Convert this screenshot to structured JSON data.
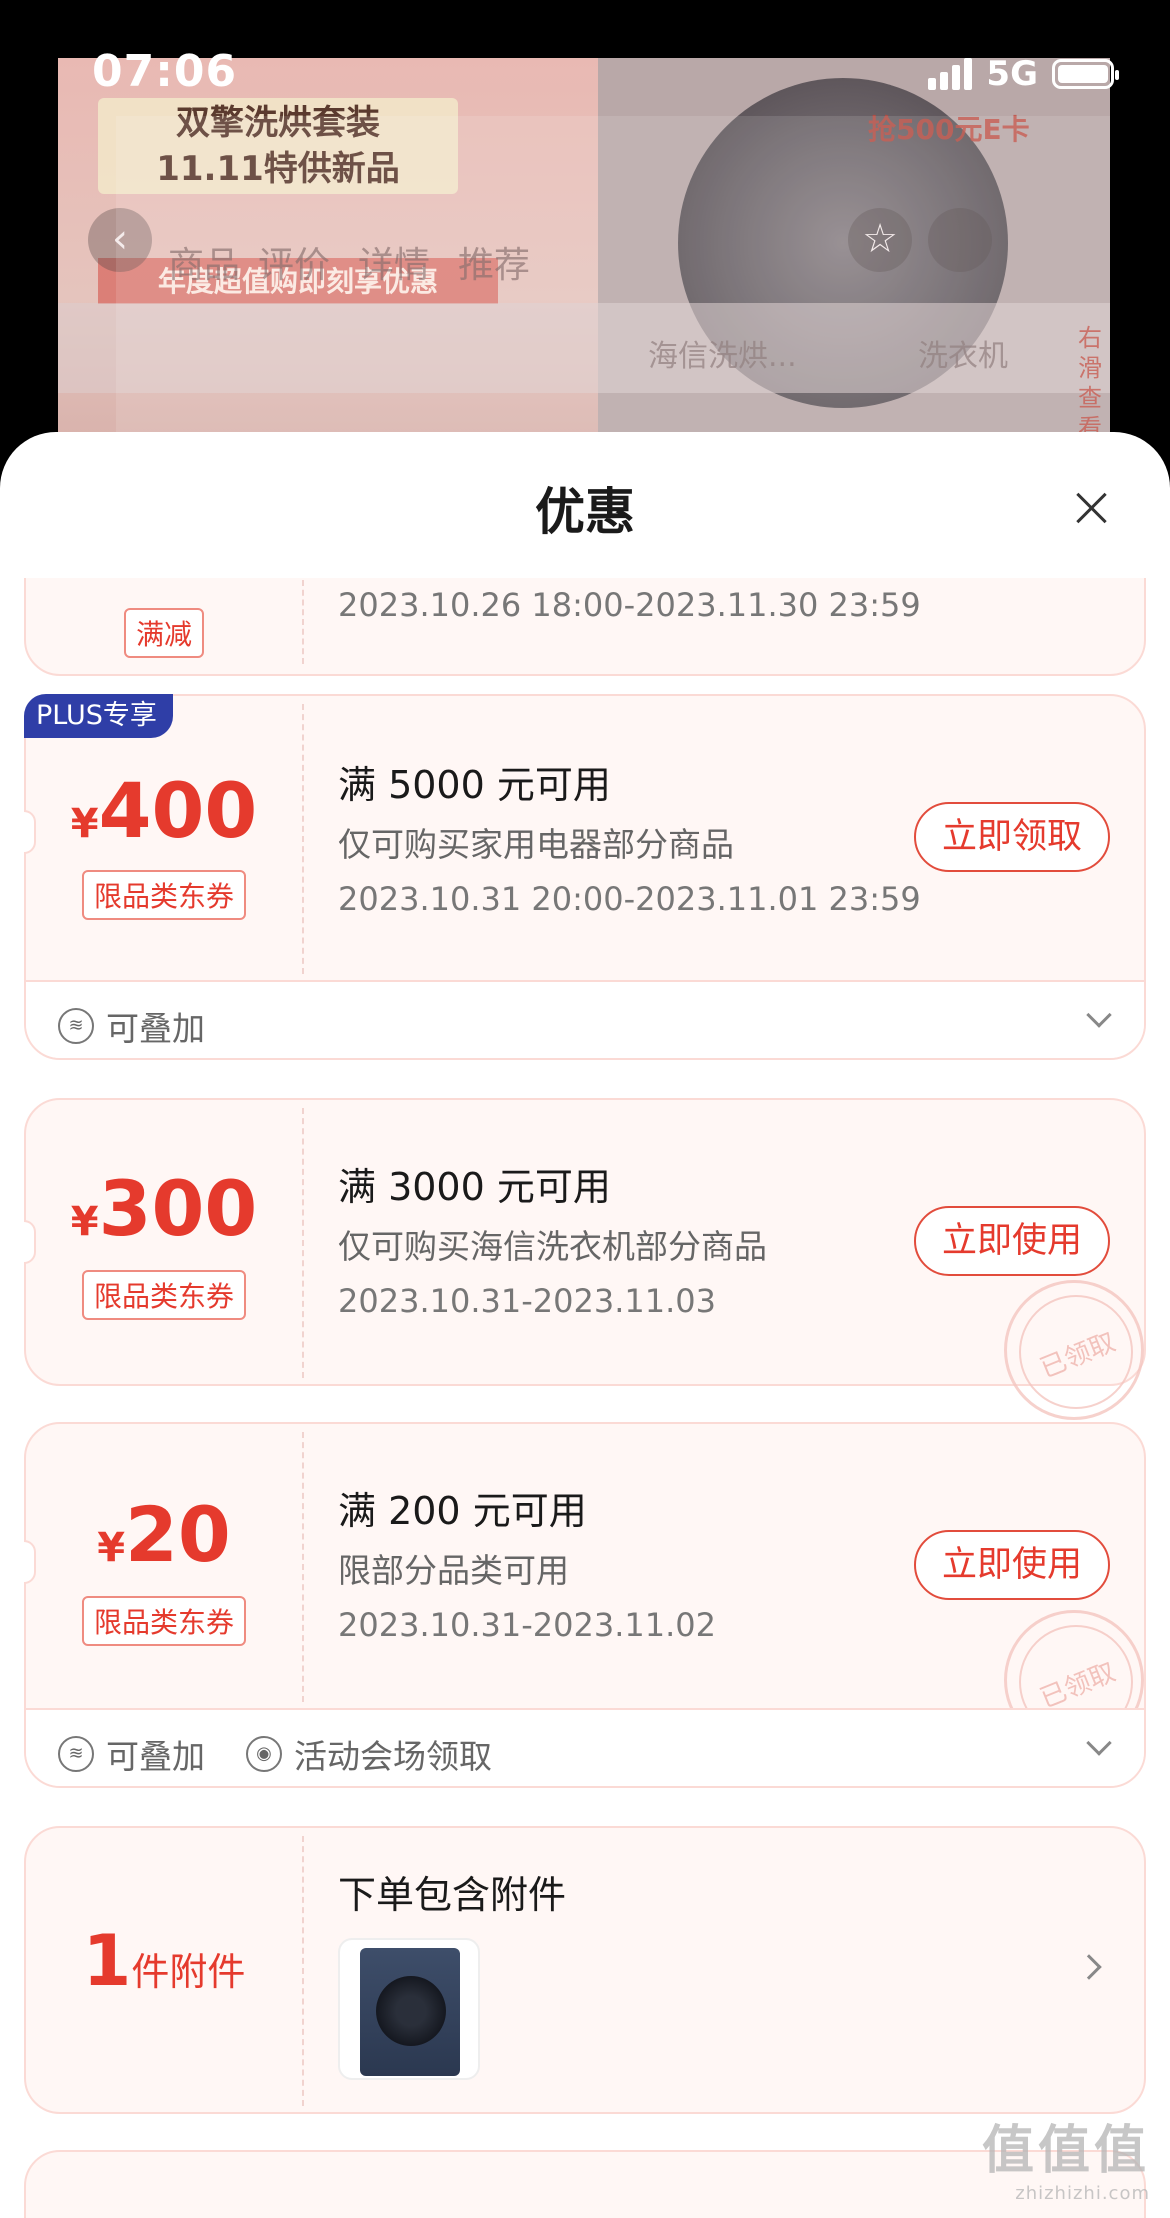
{
  "status_bar": {
    "time": "07:06",
    "network": "5G"
  },
  "background": {
    "promo_line1": "双擎洗烘套装",
    "promo_line2": "11.11特供新品",
    "promo_strip": "年度超值购即刻享优惠",
    "tabs": [
      "商品",
      "评价",
      "详情",
      "推荐"
    ],
    "gray_tabs": [
      "海信洗烘...",
      "洗衣机"
    ],
    "side_text": "右滑查看",
    "ribbon": "抢500元E卡"
  },
  "sheet": {
    "title": "优惠"
  },
  "coupons": [
    {
      "tag": "满减",
      "date": "2023.10.26 18:00-2023.11.30 23:59"
    },
    {
      "badge": "PLUS专享",
      "currency": "¥",
      "amount": "400",
      "tag": "限品类东券",
      "title": "满 5000 元可用",
      "desc": "仅可购买家用电器部分商品",
      "date": "2023.10.31 20:00-2023.11.01 23:59",
      "button": "立即领取",
      "footer_items": [
        "可叠加"
      ]
    },
    {
      "currency": "¥",
      "amount": "300",
      "tag": "限品类东券",
      "title": "满 3000 元可用",
      "desc": "仅可购买海信洗衣机部分商品",
      "date": "2023.10.31-2023.11.03",
      "button": "立即使用",
      "stamp": "已领取"
    },
    {
      "currency": "¥",
      "amount": "20",
      "tag": "限品类东券",
      "title": "满 200 元可用",
      "desc": "限部分品类可用",
      "date": "2023.10.31-2023.11.02",
      "button": "立即使用",
      "stamp": "已领取",
      "footer_items": [
        "可叠加",
        "活动会场领取"
      ]
    }
  ],
  "accessory": {
    "count": "1",
    "unit": "件附件",
    "title": "下单包含附件"
  },
  "watermark": {
    "text": "值值值",
    "site": "zhizhizhi.com"
  }
}
